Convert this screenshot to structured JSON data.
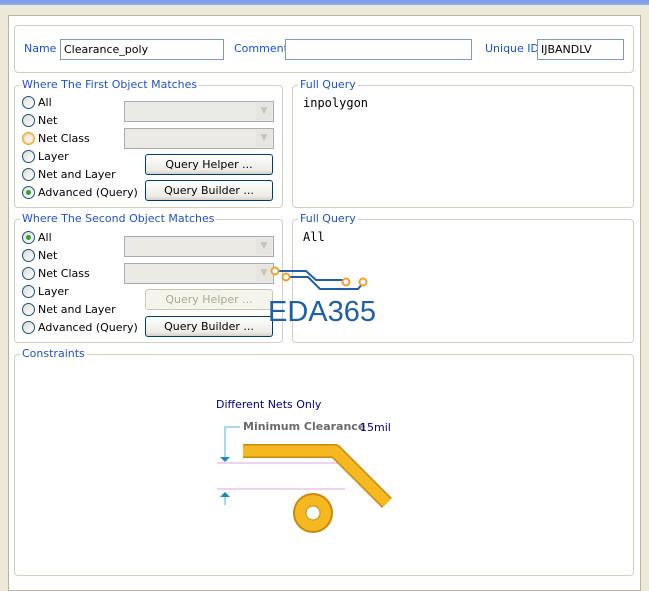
{
  "header": {
    "name_label": "Name",
    "name_value": "Clearance_poly",
    "comment_label": "Comment",
    "comment_value": "",
    "uid_label": "Unique ID",
    "uid_value": "IJBANDLV"
  },
  "first": {
    "title": "Where The First Object Matches",
    "options": [
      "All",
      "Net",
      "Net Class",
      "Layer",
      "Net and Layer",
      "Advanced (Query)"
    ],
    "selected": "Advanced (Query)",
    "query_helper": "Query Helper ...",
    "query_builder": "Query Builder ...",
    "full_query_title": "Full Query",
    "full_query": "inpolygon"
  },
  "second": {
    "title": "Where The Second Object Matches",
    "options": [
      "All",
      "Net",
      "Net Class",
      "Layer",
      "Net and Layer",
      "Advanced (Query)"
    ],
    "selected": "All",
    "query_helper": "Query Helper ...",
    "query_builder": "Query Builder ...",
    "full_query_title": "Full Query",
    "full_query": "All"
  },
  "constraints": {
    "title": "Constraints",
    "net_scope": "Different Nets Only",
    "min_clearance_label": "Minimum Clearance",
    "min_clearance_value": "15mil"
  },
  "watermark": {
    "logo_text": "EDA365"
  },
  "colors": {
    "accent": "#2150c8",
    "track": "#f5b820",
    "watermark": "#1f5fa8"
  }
}
